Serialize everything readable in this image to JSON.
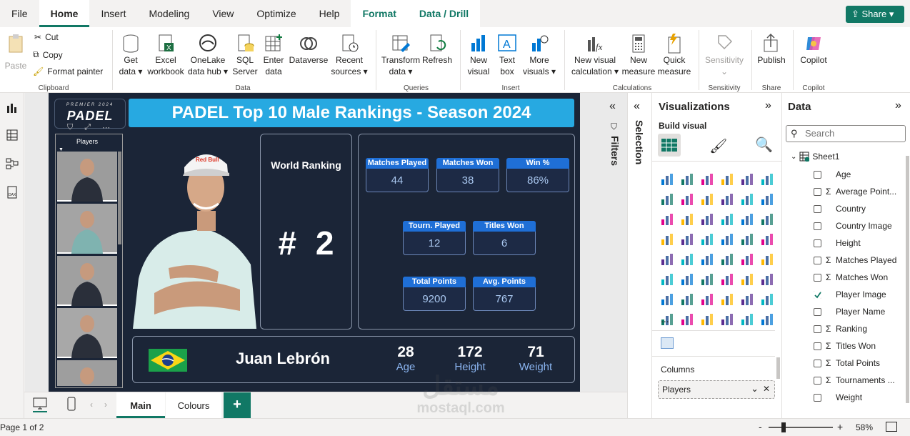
{
  "menu": {
    "items": [
      "File",
      "Home",
      "Insert",
      "Modeling",
      "View",
      "Optimize",
      "Help",
      "Format",
      "Data / Drill"
    ],
    "share": "Share"
  },
  "ribbon": {
    "clipboard": {
      "paste": "Paste",
      "cut": "Cut",
      "copy": "Copy",
      "format_painter": "Format painter",
      "group": "Clipboard"
    },
    "data": {
      "get_data": [
        "Get",
        "data ▾"
      ],
      "excel": [
        "Excel",
        "workbook"
      ],
      "onelake": [
        "OneLake",
        "data hub ▾"
      ],
      "sql": [
        "SQL",
        "Server"
      ],
      "enter": [
        "Enter",
        "data"
      ],
      "dataverse": "Dataverse",
      "recent": [
        "Recent",
        "sources ▾"
      ],
      "group": "Data"
    },
    "queries": {
      "transform": [
        "Transform",
        "data ▾"
      ],
      "refresh": "Refresh",
      "group": "Queries"
    },
    "insert": {
      "new_visual": [
        "New",
        "visual"
      ],
      "text_box": [
        "Text",
        "box"
      ],
      "more_visuals": [
        "More",
        "visuals ▾"
      ],
      "group": "Insert"
    },
    "calculations": {
      "new_visual_calc": [
        "New visual",
        "calculation ▾"
      ],
      "new_measure": [
        "New",
        "measure"
      ],
      "quick_measure": [
        "Quick",
        "measure"
      ],
      "group": "Calculations"
    },
    "sensitivity": {
      "label": "Sensitivity",
      "group": "Sensitivity"
    },
    "share": {
      "publish": "Publish",
      "group": "Share"
    },
    "copilot": {
      "label": "Copilot",
      "group": "Copilot"
    }
  },
  "report": {
    "logo_small": "PREMIER 2024",
    "logo": "PADEL",
    "title": "PADEL Top 10 Male Rankings - Season 2024",
    "slicer_title": "Players",
    "world_ranking_label": "World Ranking",
    "rank": "# 2",
    "cards": [
      {
        "label": "Matches Played",
        "value": "44"
      },
      {
        "label": "Matches Won",
        "value": "38"
      },
      {
        "label": "Win %",
        "value": "86%"
      },
      {
        "label": "Tourn. Played",
        "value": "12"
      },
      {
        "label": "Titles Won",
        "value": "6"
      },
      {
        "label": "Total Points",
        "value": "9200"
      },
      {
        "label": "Avg. Points",
        "value": "767"
      }
    ],
    "player_name": "Juan Lebrón",
    "age": {
      "value": "28",
      "label": "Age"
    },
    "height": {
      "value": "172",
      "label": "Height"
    },
    "weight": {
      "value": "71",
      "label": "Weight"
    }
  },
  "panes": {
    "filters": "Filters",
    "selection": "Selection",
    "viz": {
      "title": "Visualizations",
      "build": "Build visual",
      "more": "...",
      "columns_label": "Columns",
      "columns_value": "Players"
    },
    "data": {
      "title": "Data",
      "search_placeholder": "Search",
      "table": "Sheet1",
      "fields": [
        {
          "name": "Age",
          "sigma": false,
          "checked": false
        },
        {
          "name": "Average Point...",
          "sigma": true,
          "checked": false
        },
        {
          "name": "Country",
          "sigma": false,
          "checked": false
        },
        {
          "name": "Country Image",
          "sigma": false,
          "checked": false
        },
        {
          "name": "Height",
          "sigma": false,
          "checked": false
        },
        {
          "name": "Matches Played",
          "sigma": true,
          "checked": false
        },
        {
          "name": "Matches Won",
          "sigma": true,
          "checked": false
        },
        {
          "name": "Player Image",
          "sigma": false,
          "checked": true
        },
        {
          "name": "Player Name",
          "sigma": false,
          "checked": false
        },
        {
          "name": "Ranking",
          "sigma": true,
          "checked": false
        },
        {
          "name": "Titles Won",
          "sigma": true,
          "checked": false
        },
        {
          "name": "Total Points",
          "sigma": true,
          "checked": false
        },
        {
          "name": "Tournaments ...",
          "sigma": true,
          "checked": false
        },
        {
          "name": "Weight",
          "sigma": false,
          "checked": false
        }
      ]
    }
  },
  "tabs": {
    "items": [
      "Main",
      "Colours"
    ],
    "add": "+"
  },
  "status": {
    "page": "Page 1 of 2",
    "zoom": "58%",
    "minus": "-",
    "plus": "+"
  },
  "watermark": {
    "arabic": "مستقل",
    "latin": "mostaql.com"
  },
  "colors": {
    "accent": "#117865",
    "report_bg": "#1b2537",
    "title_bar": "#27a9e1",
    "card_header": "#1f6fd6"
  }
}
